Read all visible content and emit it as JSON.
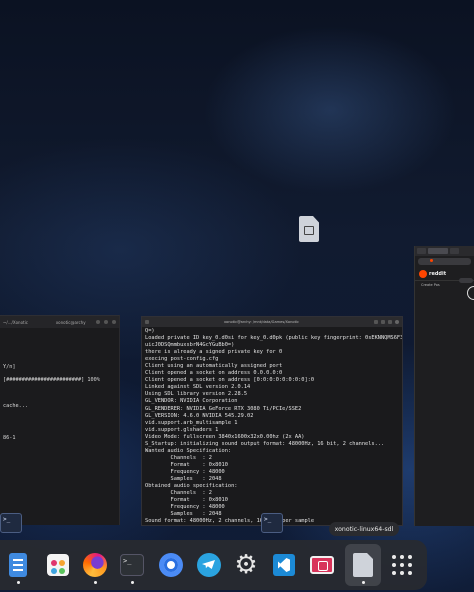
{
  "main_terminal": {
    "title": "xonotic@archy: /mnt/data/Games/Xonotic",
    "lines": [
      "Q=)",
      "Loaded private ID key_0.d0si for key_0.d0pk (public key fingerprint: 0sEKNNQMS6F3OPsj",
      "uicJ0DSQmmbuxsbrN4GcYGuBb0=)",
      "there is already a signed private key for 0",
      "execing post-config.cfg",
      "Client using an automatically assigned port",
      "Client opened a socket on address 0.0.0.0:0",
      "Client opened a socket on address [0:0:0:0:0:0:0:0]:0",
      "Linked against SDL version 2.0.14",
      "Using SDL library version 2.28.5",
      "GL_VENDOR: NVIDIA Corporation",
      "GL_RENDERER: NVIDIA GeForce RTX 3080 Ti/PCIe/SSE2",
      "GL_VERSION: 4.6.0 NVIDIA 545.29.02",
      "vid.support.arb_multisample 1",
      "vid.support.glshaders 1",
      "Video Mode: fullscreen 3840x1600x32x0.00hz (2x AA)",
      "S_Startup: initializing sound output format: 48000Hz, 16 bit, 2 channels...",
      "Wanted audio Specification:",
      "        Channels  : 2",
      "        Format    : 0x8010",
      "        Frequency : 48000",
      "        Samples   : 2048",
      "Obtained audio specification:",
      "        Channels  : 2",
      "        Format    : 0x8010",
      "        Frequency : 48000",
      "        Samples   : 2048",
      "Sound format: 48000Hz, 2 channels, 16 bits per sample",
      "CDAudio_Init: No CD in player.",
      "Can't get initial CD volume",
      "CD Audio Initialized"
    ]
  },
  "left_terminal": {
    "title": "~/.../Xonotic",
    "subtitle": "xonotic@archy",
    "lines": [
      "",
      "",
      "",
      "",
      "",
      "Y/n]",
      "",
      "[########################] 100%",
      "",
      "",
      "",
      "cache...",
      "",
      "",
      "",
      "",
      "86-1"
    ]
  },
  "browser": {
    "site": "reddit",
    "sub_text": "Create Pos"
  },
  "tooltip": "xonotic-linux64-sdl",
  "dock": {
    "items": [
      {
        "name": "files-icon",
        "label": "Files"
      },
      {
        "name": "store-icon",
        "label": "Store"
      },
      {
        "name": "firefox-icon",
        "label": "Firefox"
      },
      {
        "name": "terminal-icon",
        "label": "Terminal"
      },
      {
        "name": "chromium-icon",
        "label": "Chromium"
      },
      {
        "name": "telegram-icon",
        "label": "Telegram"
      },
      {
        "name": "settings-icon",
        "label": "Settings"
      },
      {
        "name": "vscode-icon",
        "label": "VS Code"
      },
      {
        "name": "xonotic-icon",
        "label": "Xonotic"
      },
      {
        "name": "xonotic-sdl-icon",
        "label": "xonotic-linux64-sdl"
      },
      {
        "name": "app-grid-icon",
        "label": "Show Apps"
      }
    ],
    "terminal_glyph": ">_"
  }
}
